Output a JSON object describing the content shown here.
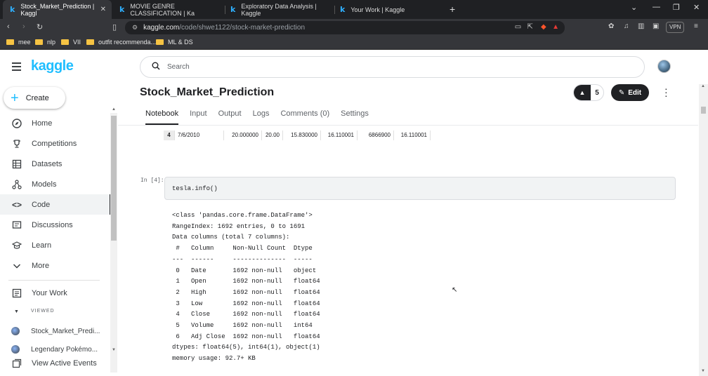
{
  "browser": {
    "tabs": [
      {
        "title": "Stock_Market_Prediction | Kaggl",
        "active": true
      },
      {
        "title": "MOVIE GENRE CLASSIFICATION | Ka",
        "active": false
      },
      {
        "title": "Exploratory Data Analysis | Kaggle",
        "active": false
      },
      {
        "title": "Your Work | Kaggle",
        "active": false
      }
    ],
    "url_domain": "kaggle.com",
    "url_path": "/code/shwe1122/stock-market-prediction",
    "vpn_label": "VPN",
    "bookmarks": [
      "mee",
      "nlp",
      "VII",
      "outfit recommenda...",
      "ML & DS"
    ]
  },
  "sidebar": {
    "logo": "kaggle",
    "create_label": "Create",
    "items": [
      {
        "label": "Home",
        "icon": "compass-icon"
      },
      {
        "label": "Competitions",
        "icon": "trophy-icon"
      },
      {
        "label": "Datasets",
        "icon": "table-icon"
      },
      {
        "label": "Models",
        "icon": "models-icon"
      },
      {
        "label": "Code",
        "icon": "code-icon",
        "active": true
      },
      {
        "label": "Discussions",
        "icon": "discussions-icon"
      },
      {
        "label": "Learn",
        "icon": "learn-icon"
      },
      {
        "label": "More",
        "icon": "chevron-down-icon"
      }
    ],
    "your_work": "Your Work",
    "viewed_header": "VIEWED",
    "recent": [
      "Stock_Market_Predi...",
      "Legendary Pokémo..."
    ],
    "view_active_events": "View Active Events"
  },
  "header": {
    "search_placeholder": "Search",
    "notebook_title": "Stock_Market_Prediction",
    "vote_count": "5",
    "edit_label": "Edit",
    "tabs": [
      "Notebook",
      "Input",
      "Output",
      "Logs",
      "Comments (0)",
      "Settings"
    ],
    "active_tab": "Notebook"
  },
  "notebook": {
    "df_row": [
      "4",
      "7/6/2010",
      "20.000000",
      "20.00",
      "15.830000",
      "16.110001",
      "6866900",
      "16.110001"
    ],
    "cell_label": "In [4]:",
    "code": "tesla.info()",
    "output_lines": [
      "<class 'pandas.core.frame.DataFrame'>",
      "RangeIndex: 1692 entries, 0 to 1691",
      "Data columns (total 7 columns):",
      " #   Column     Non-Null Count  Dtype  ",
      "---  ------     --------------  -----  ",
      " 0   Date       1692 non-null   object ",
      " 1   Open       1692 non-null   float64",
      " 2   High       1692 non-null   float64",
      " 3   Low        1692 non-null   float64",
      " 4   Close      1692 non-null   float64",
      " 5   Volume     1692 non-null   int64  ",
      " 6   Adj Close  1692 non-null   float64",
      "dtypes: float64(5), int64(1), object(1)",
      "memory usage: 92.7+ KB"
    ]
  }
}
